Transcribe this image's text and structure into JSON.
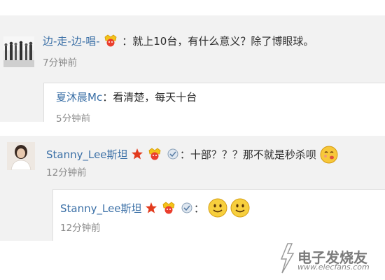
{
  "comment1": {
    "author": "边-走-边-唱-",
    "colon": "：",
    "text": "就上10台，有什么意义？除了博眼球。",
    "time": "7分钟前"
  },
  "reply1": {
    "author": "夏沐晨Mc",
    "colon": "：",
    "text": "看清楚，每天十台",
    "time": "5分钟前"
  },
  "comment2": {
    "author": "Stanny_Lee斯坦",
    "colon": "：",
    "text": "十部？？？那不就是秒杀呗",
    "time": "12分钟前"
  },
  "reply2": {
    "author": "Stanny_Lee斯坦",
    "colon": "：",
    "time": "12分钟前"
  },
  "watermark": {
    "title": "电子发烧友",
    "url": "www.elecfans.com"
  },
  "icons": {
    "emoji_smile": "smile-emoji-icon",
    "emoji_kiss": "kiss-emoji-icon",
    "vip_badge": "vip-badge-icon",
    "star_badge": "star-badge-icon",
    "medal_badge": "medal-badge-icon"
  },
  "colors": {
    "name": "#3a6fa6",
    "panel": "#f2f2f2",
    "time": "#8a8a8a"
  }
}
